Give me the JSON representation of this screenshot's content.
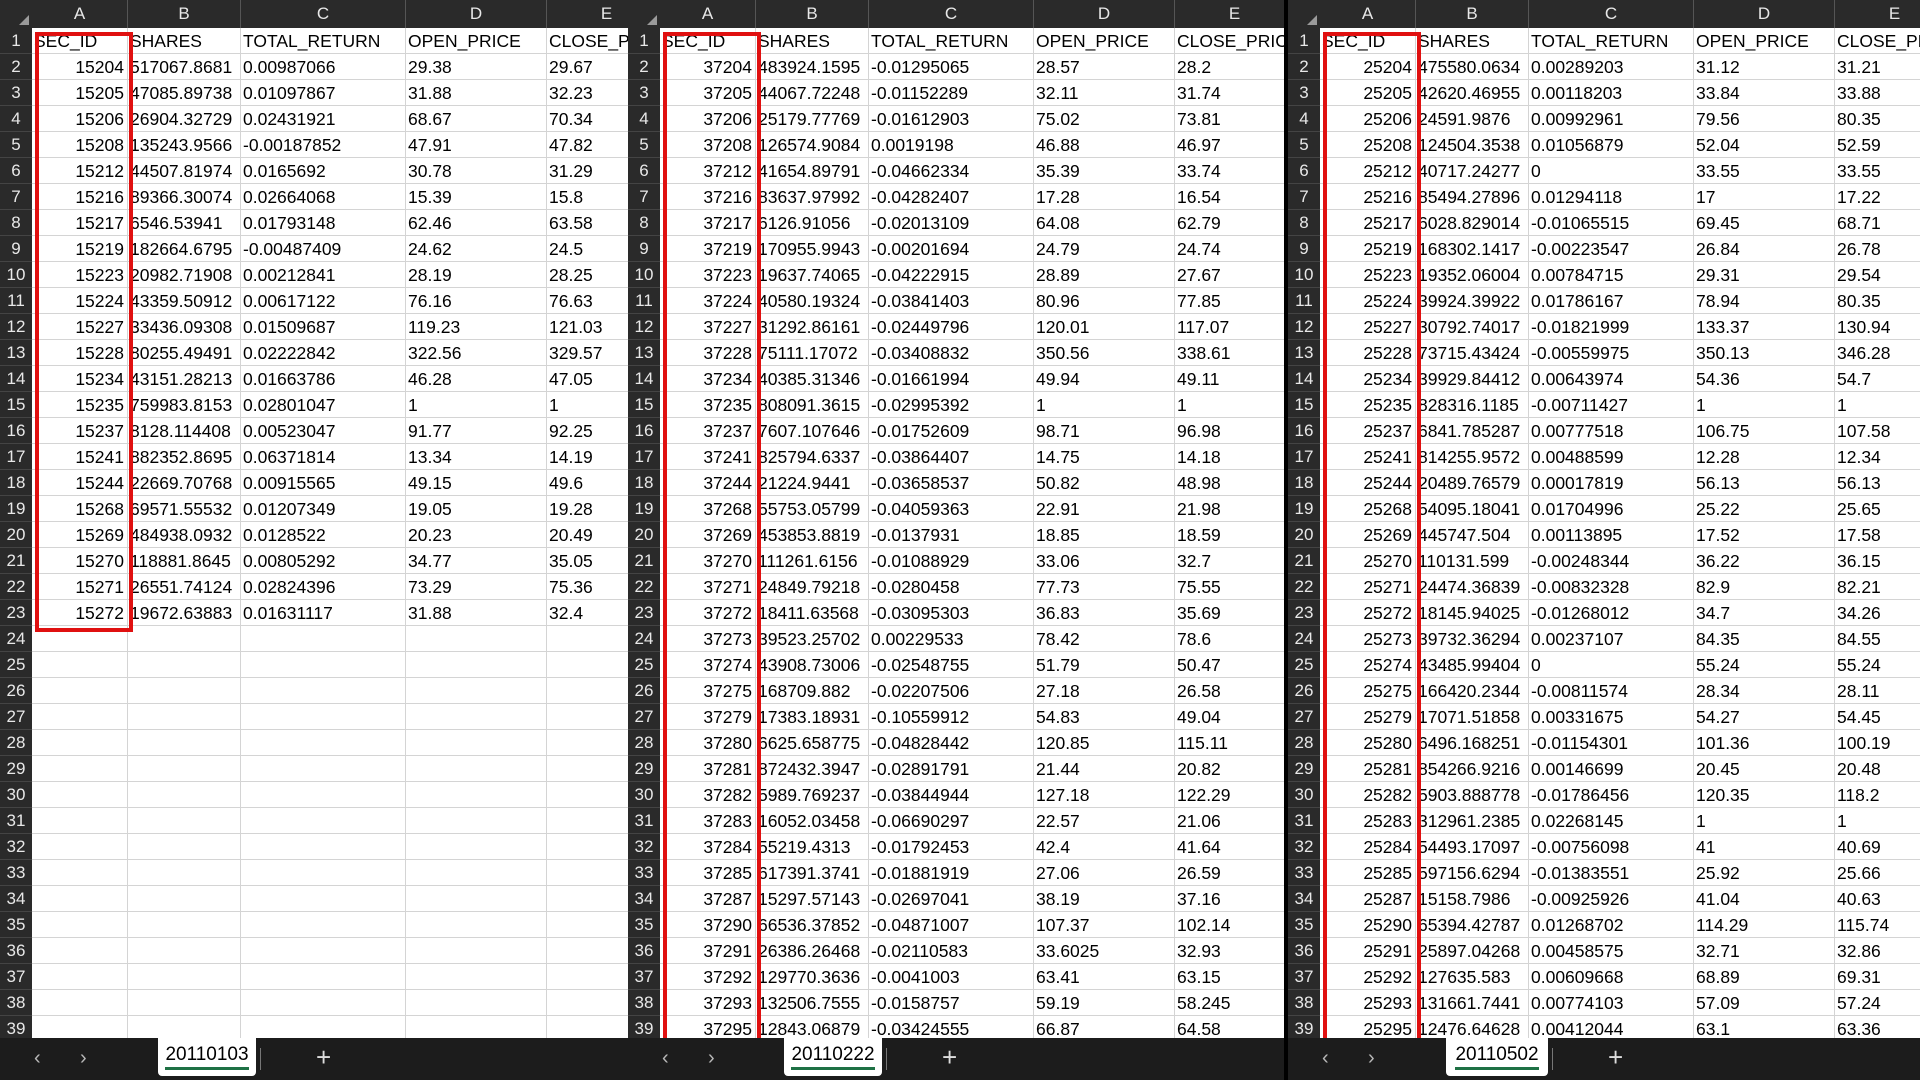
{
  "columns": [
    {
      "letter": "A",
      "header": "SEC_ID"
    },
    {
      "letter": "B",
      "header": "SHARES"
    },
    {
      "letter": "C",
      "header": "TOTAL_RETURN"
    },
    {
      "letter": "D",
      "header": "OPEN_PRICE"
    },
    {
      "letter": "E",
      "header": "CLOSE_PRICE"
    }
  ],
  "add_sheet_label": "+",
  "panels": [
    {
      "sheet_tab": "20110103",
      "rows": [
        [
          "15204",
          "517067.8681",
          "0.00987066",
          "29.38",
          "29.67"
        ],
        [
          "15205",
          "47085.89738",
          "0.01097867",
          "31.88",
          "32.23"
        ],
        [
          "15206",
          "26904.32729",
          "0.02431921",
          "68.67",
          "70.34"
        ],
        [
          "15208",
          "135243.9566",
          "-0.00187852",
          "47.91",
          "47.82"
        ],
        [
          "15212",
          "44507.81974",
          "0.0165692",
          "30.78",
          "31.29"
        ],
        [
          "15216",
          "89366.30074",
          "0.02664068",
          "15.39",
          "15.8"
        ],
        [
          "15217",
          "6546.53941",
          "0.01793148",
          "62.46",
          "63.58"
        ],
        [
          "15219",
          "182664.6795",
          "-0.00487409",
          "24.62",
          "24.5"
        ],
        [
          "15223",
          "20982.71908",
          "0.00212841",
          "28.19",
          "28.25"
        ],
        [
          "15224",
          "43359.50912",
          "0.00617122",
          "76.16",
          "76.63"
        ],
        [
          "15227",
          "33436.09308",
          "0.01509687",
          "119.23",
          "121.03"
        ],
        [
          "15228",
          "80255.49491",
          "0.02222842",
          "322.56",
          "329.57"
        ],
        [
          "15234",
          "43151.28213",
          "0.01663786",
          "46.28",
          "47.05"
        ],
        [
          "15235",
          "759983.8153",
          "0.02801047",
          "1",
          "1"
        ],
        [
          "15237",
          "8128.114408",
          "0.00523047",
          "91.77",
          "92.25"
        ],
        [
          "15241",
          "882352.8695",
          "0.06371814",
          "13.34",
          "14.19"
        ],
        [
          "15244",
          "22669.70768",
          "0.00915565",
          "49.15",
          "49.6"
        ],
        [
          "15268",
          "69571.55532",
          "0.01207349",
          "19.05",
          "19.28"
        ],
        [
          "15269",
          "484938.0932",
          "0.0128522",
          "20.23",
          "20.49"
        ],
        [
          "15270",
          "118881.8645",
          "0.00805292",
          "34.77",
          "35.05"
        ],
        [
          "15271",
          "26551.74124",
          "0.02824396",
          "73.29",
          "75.36"
        ],
        [
          "15272",
          "19672.63883",
          "0.01631117",
          "31.88",
          "32.4"
        ]
      ]
    },
    {
      "sheet_tab": "20110222",
      "rows": [
        [
          "37204",
          "483924.1595",
          "-0.01295065",
          "28.57",
          "28.2"
        ],
        [
          "37205",
          "44067.72248",
          "-0.01152289",
          "32.11",
          "31.74"
        ],
        [
          "37206",
          "25179.77769",
          "-0.01612903",
          "75.02",
          "73.81"
        ],
        [
          "37208",
          "126574.9084",
          "0.0019198",
          "46.88",
          "46.97"
        ],
        [
          "37212",
          "41654.89791",
          "-0.04662334",
          "35.39",
          "33.74"
        ],
        [
          "37216",
          "83637.97992",
          "-0.04282407",
          "17.28",
          "16.54"
        ],
        [
          "37217",
          "6126.91056",
          "-0.02013109",
          "64.08",
          "62.79"
        ],
        [
          "37219",
          "170955.9943",
          "-0.00201694",
          "24.79",
          "24.74"
        ],
        [
          "37223",
          "19637.74065",
          "-0.04222915",
          "28.89",
          "27.67"
        ],
        [
          "37224",
          "40580.19324",
          "-0.03841403",
          "80.96",
          "77.85"
        ],
        [
          "37227",
          "31292.86161",
          "-0.02449796",
          "120.01",
          "117.07"
        ],
        [
          "37228",
          "75111.17072",
          "-0.03408832",
          "350.56",
          "338.61"
        ],
        [
          "37234",
          "40385.31346",
          "-0.01661994",
          "49.94",
          "49.11"
        ],
        [
          "37235",
          "808091.3615",
          "-0.02995392",
          "1",
          "1"
        ],
        [
          "37237",
          "7607.107646",
          "-0.01752609",
          "98.71",
          "96.98"
        ],
        [
          "37241",
          "825794.6337",
          "-0.03864407",
          "14.75",
          "14.18"
        ],
        [
          "37244",
          "21224.9441",
          "-0.03658537",
          "50.82",
          "48.98"
        ],
        [
          "37268",
          "55753.05799",
          "-0.04059363",
          "22.91",
          "21.98"
        ],
        [
          "37269",
          "453853.8819",
          "-0.0137931",
          "18.85",
          "18.59"
        ],
        [
          "37270",
          "111261.6156",
          "-0.01088929",
          "33.06",
          "32.7"
        ],
        [
          "37271",
          "24849.79218",
          "-0.0280458",
          "77.73",
          "75.55"
        ],
        [
          "37272",
          "18411.63568",
          "-0.03095303",
          "36.83",
          "35.69"
        ],
        [
          "37273",
          "39523.25702",
          "0.00229533",
          "78.42",
          "78.6"
        ],
        [
          "37274",
          "43908.73006",
          "-0.02548755",
          "51.79",
          "50.47"
        ],
        [
          "37275",
          "168709.882",
          "-0.02207506",
          "27.18",
          "26.58"
        ],
        [
          "37279",
          "17383.18931",
          "-0.10559912",
          "54.83",
          "49.04"
        ],
        [
          "37280",
          "6625.658775",
          "-0.04828442",
          "120.85",
          "115.11"
        ],
        [
          "37281",
          "872432.3947",
          "-0.02891791",
          "21.44",
          "20.82"
        ],
        [
          "37282",
          "5989.769237",
          "-0.03844944",
          "127.18",
          "122.29"
        ],
        [
          "37283",
          "16052.03458",
          "-0.06690297",
          "22.57",
          "21.06"
        ],
        [
          "37284",
          "55219.4313",
          "-0.01792453",
          "42.4",
          "41.64"
        ],
        [
          "37285",
          "617391.3741",
          "-0.01881919",
          "27.06",
          "26.59"
        ],
        [
          "37287",
          "15297.57143",
          "-0.02697041",
          "38.19",
          "37.16"
        ],
        [
          "37290",
          "66536.37852",
          "-0.04871007",
          "107.37",
          "102.14"
        ],
        [
          "37291",
          "26386.26468",
          "-0.02110583",
          "33.6025",
          "32.93"
        ],
        [
          "37292",
          "129770.3636",
          "-0.0041003",
          "63.41",
          "63.15"
        ],
        [
          "37293",
          "132506.7555",
          "-0.0158757",
          "59.19",
          "58.245"
        ],
        [
          "37295",
          "12843.06879",
          "-0.03424555",
          "66.87",
          "64.58"
        ]
      ]
    },
    {
      "sheet_tab": "20110502",
      "rows": [
        [
          "25204",
          "475580.0634",
          "0.00289203",
          "31.12",
          "31.21"
        ],
        [
          "25205",
          "42620.46955",
          "0.00118203",
          "33.84",
          "33.88"
        ],
        [
          "25206",
          "24591.9876",
          "0.00992961",
          "79.56",
          "80.35"
        ],
        [
          "25208",
          "124504.3538",
          "0.01056879",
          "52.04",
          "52.59"
        ],
        [
          "25212",
          "40717.24277",
          "0",
          "33.55",
          "33.55"
        ],
        [
          "25216",
          "85494.27896",
          "0.01294118",
          "17",
          "17.22"
        ],
        [
          "25217",
          "6028.829014",
          "-0.01065515",
          "69.45",
          "68.71"
        ],
        [
          "25219",
          "168302.1417",
          "-0.00223547",
          "26.84",
          "26.78"
        ],
        [
          "25223",
          "19352.06004",
          "0.00784715",
          "29.31",
          "29.54"
        ],
        [
          "25224",
          "39924.39922",
          "0.01786167",
          "78.94",
          "80.35"
        ],
        [
          "25227",
          "30792.74017",
          "-0.01821999",
          "133.37",
          "130.94"
        ],
        [
          "25228",
          "73715.43424",
          "-0.00559975",
          "350.13",
          "346.28"
        ],
        [
          "25234",
          "39929.84412",
          "0.00643974",
          "54.36",
          "54.7"
        ],
        [
          "25235",
          "828316.1185",
          "-0.00711427",
          "1",
          "1"
        ],
        [
          "25237",
          "6841.785287",
          "0.00777518",
          "106.75",
          "107.58"
        ],
        [
          "25241",
          "814255.9572",
          "0.00488599",
          "12.28",
          "12.34"
        ],
        [
          "25244",
          "20489.76579",
          "0.00017819",
          "56.13",
          "56.13"
        ],
        [
          "25268",
          "54095.18041",
          "0.01704996",
          "25.22",
          "25.65"
        ],
        [
          "25269",
          "445747.504",
          "0.00113895",
          "17.52",
          "17.58"
        ],
        [
          "25270",
          "110131.599",
          "-0.00248344",
          "36.22",
          "36.15"
        ],
        [
          "25271",
          "24474.36839",
          "-0.00832328",
          "82.9",
          "82.21"
        ],
        [
          "25272",
          "18145.94025",
          "-0.01268012",
          "34.7",
          "34.26"
        ],
        [
          "25273",
          "39732.36294",
          "0.00237107",
          "84.35",
          "84.55"
        ],
        [
          "25274",
          "43485.99404",
          "0",
          "55.24",
          "55.24"
        ],
        [
          "25275",
          "166420.2344",
          "-0.00811574",
          "28.34",
          "28.11"
        ],
        [
          "25279",
          "17071.51858",
          "0.00331675",
          "54.27",
          "54.45"
        ],
        [
          "25280",
          "6496.168251",
          "-0.01154301",
          "101.36",
          "100.19"
        ],
        [
          "25281",
          "854266.9216",
          "0.00146699",
          "20.45",
          "20.48"
        ],
        [
          "25282",
          "5903.888778",
          "-0.01786456",
          "120.35",
          "118.2"
        ],
        [
          "25283",
          "312961.2385",
          "0.02268145",
          "1",
          "1"
        ],
        [
          "25284",
          "54493.17097",
          "-0.00756098",
          "41",
          "40.69"
        ],
        [
          "25285",
          "597156.6294",
          "-0.01383551",
          "25.92",
          "25.66"
        ],
        [
          "25287",
          "15158.7986",
          "-0.00925926",
          "41.04",
          "40.63"
        ],
        [
          "25290",
          "65394.42787",
          "0.01268702",
          "114.29",
          "115.74"
        ],
        [
          "25291",
          "25897.04268",
          "0.00458575",
          "32.71",
          "32.86"
        ],
        [
          "25292",
          "127635.583",
          "0.00609668",
          "68.89",
          "69.31"
        ],
        [
          "25293",
          "131661.7441",
          "0.00774103",
          "57.09",
          "57.24"
        ],
        [
          "25295",
          "12476.64628",
          "0.00412044",
          "63.1",
          "63.36"
        ]
      ]
    }
  ]
}
